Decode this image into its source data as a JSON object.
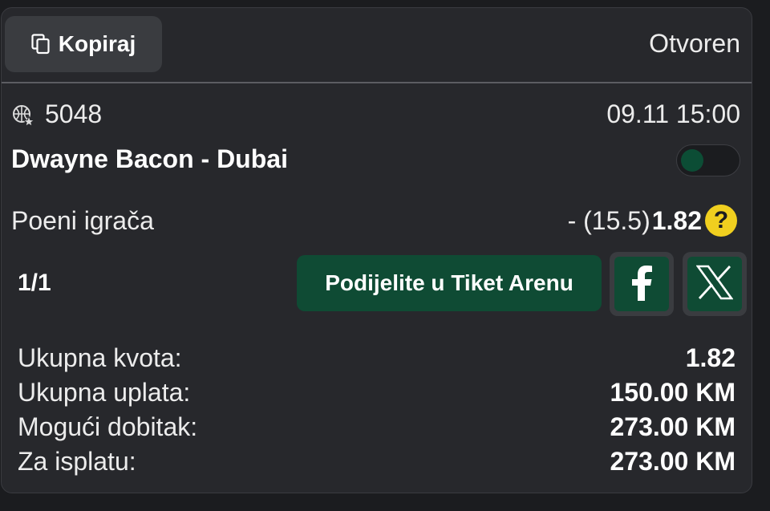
{
  "header": {
    "copy_label": "Kopiraj",
    "copy_icon": "copy-icon",
    "status": "Otvoren"
  },
  "event": {
    "sport_icon": "basketball-star-icon",
    "id": "5048",
    "datetime": "09.11 15:00",
    "match": "Dwayne Bacon - Dubai",
    "toggle_on": false
  },
  "market": {
    "name": "Poeni igrača",
    "pick": "- (15.5)",
    "odds": "1.82",
    "help_glyph": "?"
  },
  "ticket": {
    "fraction": "1/1",
    "share_label": "Podijelite u Tiket Arenu",
    "facebook_icon": "facebook-icon",
    "x_icon": "x-twitter-icon"
  },
  "summary": [
    {
      "label": "Ukupna kvota:",
      "value": "1.82"
    },
    {
      "label": "Ukupna uplata:",
      "value": "150.00 KM"
    },
    {
      "label": "Mogući dobitak:",
      "value": "273.00 KM"
    },
    {
      "label": "Za isplatu:",
      "value": "273.00 KM"
    }
  ],
  "colors": {
    "background": "#1b1c1f",
    "card": "#27282c",
    "accent_green": "#0f4b34",
    "help_yellow": "#f0cf1f"
  }
}
